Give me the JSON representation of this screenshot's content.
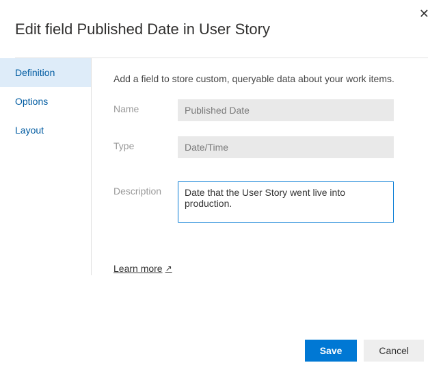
{
  "dialog": {
    "title": "Edit field Published Date in User Story"
  },
  "sidebar": {
    "items": [
      {
        "label": "Definition"
      },
      {
        "label": "Options"
      },
      {
        "label": "Layout"
      }
    ]
  },
  "main": {
    "intro": "Add a field to store custom, queryable data about your work items.",
    "fields": {
      "name": {
        "label": "Name",
        "value": "Published Date"
      },
      "type": {
        "label": "Type",
        "value": "Date/Time"
      },
      "description": {
        "label": "Description",
        "value": "Date that the User Story went live into production."
      }
    },
    "learn_more": "Learn more"
  },
  "footer": {
    "save": "Save",
    "cancel": "Cancel"
  }
}
